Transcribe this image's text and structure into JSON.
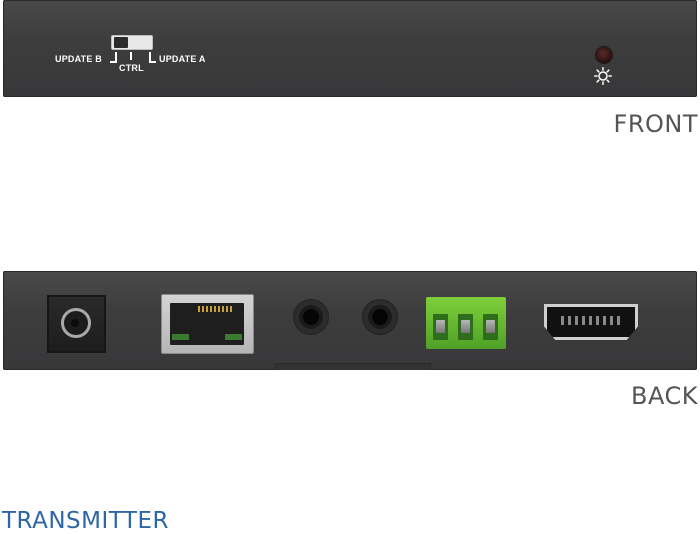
{
  "front": {
    "switch": {
      "left_label": "UPDATE B",
      "middle_label": "CTRL",
      "right_label": "UPDATE A"
    },
    "indicator_icon": "brightness-sun-icon",
    "view_label": "FRONT"
  },
  "back": {
    "ports": [
      "dc-power-jack",
      "rj45-ethernet-port",
      "audio-jack",
      "audio-jack",
      "green-terminal-block",
      "hdmi-port"
    ],
    "view_label": "BACK"
  },
  "title": "TRANSMITTER",
  "colors": {
    "panel": "#3d3d3e",
    "title": "#2e66a6",
    "terminal": "#5fb32e"
  }
}
